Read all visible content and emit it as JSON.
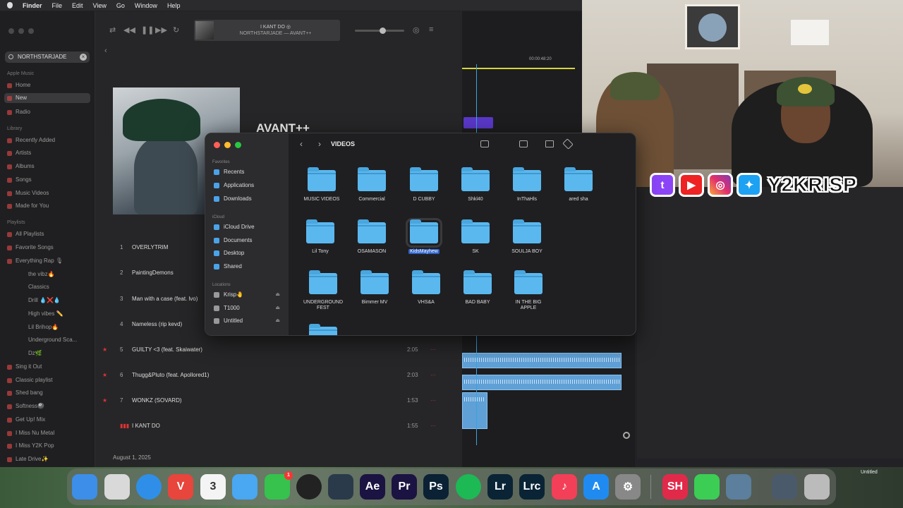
{
  "menubar": {
    "items": [
      "Finder",
      "File",
      "Edit",
      "View",
      "Go",
      "Window",
      "Help"
    ]
  },
  "music": {
    "search_value": "NORTHSTARJADE",
    "sidebar": {
      "apple_music_header": "Apple Music",
      "apple_music": [
        "Home",
        "New",
        "Radio"
      ],
      "library_header": "Library",
      "library": [
        "Recently Added",
        "Artists",
        "Albums",
        "Songs",
        "Music Videos",
        "Made for You"
      ],
      "playlists_header": "Playlists",
      "playlists": [
        "All Playlists",
        "Favorite Songs",
        "Everything Rap 🎙",
        "the vibz🔥",
        "Classics",
        "Drill 💧❌💧",
        "High vibes ✏️",
        "Lil Brihop🔥",
        "Underground Sca...",
        "Dz🌿",
        "Sing it Out",
        "Classic playlist",
        "Shed bang",
        "Softness🎱",
        "Get Up! Mix",
        "I Miss Nu Metal",
        "I Miss Y2K Pop",
        "Late Drive✨"
      ]
    },
    "now_playing": {
      "line1": "I KANT DO ◎",
      "line2": "NORTHSTARJADE — AVANT++"
    },
    "album_title": "AVANT++",
    "tracks": [
      {
        "num": "1",
        "name": "OVERLYTRIM",
        "duration": "",
        "star": ""
      },
      {
        "num": "2",
        "name": "PaintingDemons",
        "duration": "",
        "star": ""
      },
      {
        "num": "3",
        "name": "Man with a case (feat. lvo)",
        "duration": "",
        "star": ""
      },
      {
        "num": "4",
        "name": "Nameless (rip kevd)",
        "duration": "",
        "star": ""
      },
      {
        "num": "5",
        "name": "GUILTY <3 (feat. Skaiwater)",
        "duration": "2:05",
        "star": "★"
      },
      {
        "num": "6",
        "name": "Thugg&Pluto (feat. Apollored1)",
        "duration": "2:03",
        "star": "★"
      },
      {
        "num": "7",
        "name": "WONKZ (SOVARD)",
        "duration": "1:53",
        "star": "★"
      },
      {
        "num": "",
        "name": "I KANT DO",
        "duration": "1:55",
        "star": ""
      }
    ],
    "release_date": "August 1, 2025"
  },
  "timeline": {
    "timecode": "00:00:48:20"
  },
  "finder": {
    "title": "VIDEOS",
    "sections": {
      "favorites": "Favorites",
      "icloud": "iCloud",
      "locations": "Locations"
    },
    "favorites": [
      "Recents",
      "Applications",
      "Downloads"
    ],
    "icloud": [
      "iCloud Drive",
      "Documents",
      "Desktop",
      "Shared"
    ],
    "locations": [
      "Krisp🤚",
      "T1000",
      "Untitled"
    ],
    "folders": [
      "MUSIC VIDEOS",
      "Commercial",
      "D CUBBY",
      "Shkl40",
      "InThaHls",
      "ared sha",
      "Lil Tony",
      "OSAMASON",
      "KidsMayhew",
      "SK",
      "SOULJA BOY",
      "UNDERGROUND FEST",
      "Bimmer MV",
      "VHS&A",
      "BAD BABY",
      "IN THE BIG APPLE"
    ],
    "selected_folder": "KidsMayhew"
  },
  "overlay": {
    "handle": "Y2KRISP"
  },
  "dock": {
    "apps": [
      {
        "name": "finder",
        "label": "",
        "color": "#3d8ee8"
      },
      {
        "name": "launchpad",
        "label": "",
        "color": "#d9d9d9"
      },
      {
        "name": "safari",
        "label": "",
        "color": "#2f8fe8"
      },
      {
        "name": "vivaldi",
        "label": "V",
        "color": "#e8453c"
      },
      {
        "name": "calendar",
        "label": "3",
        "color": "#f4f4f4"
      },
      {
        "name": "mail",
        "label": "",
        "color": "#4aa7f1"
      },
      {
        "name": "facetime",
        "label": "",
        "color": "#36c24d"
      },
      {
        "name": "obs",
        "label": "",
        "color": "#222"
      },
      {
        "name": "davinci",
        "label": "",
        "color": "#2a3a4a"
      },
      {
        "name": "after-effects",
        "label": "Ae",
        "color": "#1b1342"
      },
      {
        "name": "premiere",
        "label": "Pr",
        "color": "#1b1342"
      },
      {
        "name": "photoshop",
        "label": "Ps",
        "color": "#0b2235"
      },
      {
        "name": "spotify",
        "label": "",
        "color": "#1db954"
      },
      {
        "name": "lightroom",
        "label": "Lr",
        "color": "#0a2436"
      },
      {
        "name": "lightroom-classic",
        "label": "Lrc",
        "color": "#0a2436"
      },
      {
        "name": "music",
        "label": "♪",
        "color": "#f33f58"
      },
      {
        "name": "app-store",
        "label": "A",
        "color": "#1f8bf1"
      },
      {
        "name": "system-settings",
        "label": "⚙",
        "color": "#888"
      },
      {
        "name": "streamlabs",
        "label": "SH",
        "color": "#e12a4a"
      },
      {
        "name": "messages",
        "label": "",
        "color": "#3ccd55"
      },
      {
        "name": "preview",
        "label": "",
        "color": "#5b7f9c"
      },
      {
        "name": "downloads-stack",
        "label": "",
        "color": "#4a5a6a"
      },
      {
        "name": "trash",
        "label": "",
        "color": "#bbb"
      }
    ],
    "facetime_badge": "1",
    "untitled_label": "Untitled"
  }
}
